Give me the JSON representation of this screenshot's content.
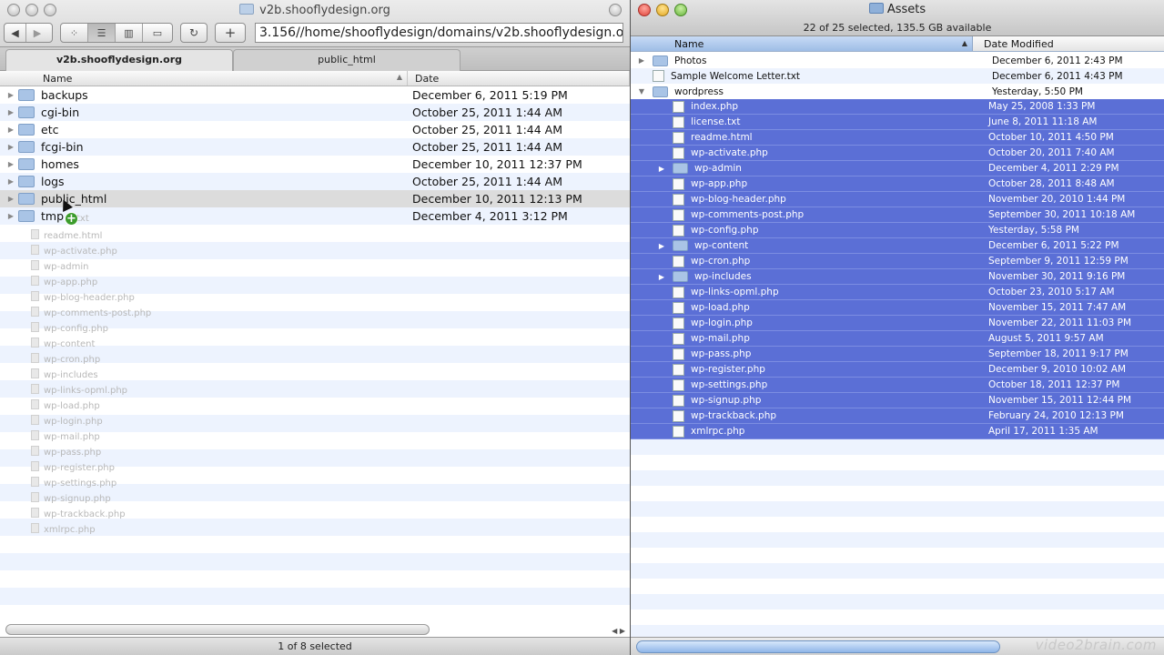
{
  "left_window": {
    "title": "v2b.shooflydesign.org",
    "path": "3.156//home/shooflydesign/domains/v2b.shooflydesign.org/",
    "add_label": "+",
    "tabs": [
      {
        "label": "v2b.shooflydesign.org"
      },
      {
        "label": "public_html"
      }
    ],
    "columns": {
      "name": "Name",
      "date": "Date"
    },
    "rows": [
      {
        "name": "backups",
        "date": "December 6, 2011 5:19 PM"
      },
      {
        "name": "cgi-bin",
        "date": "October 25, 2011 1:44 AM"
      },
      {
        "name": "etc",
        "date": "October 25, 2011 1:44 AM"
      },
      {
        "name": "fcgi-bin",
        "date": "October 25, 2011 1:44 AM"
      },
      {
        "name": "homes",
        "date": "December 10, 2011 12:37 PM"
      },
      {
        "name": "logs",
        "date": "October 25, 2011 1:44 AM"
      },
      {
        "name": "public_html",
        "date": "December 10, 2011 12:13 PM"
      },
      {
        "name": "tmp",
        "date": "December 4, 2011 3:12 PM"
      }
    ],
    "ghost_items": [
      "txt",
      "readme.html",
      "wp-activate.php",
      "wp-admin",
      "wp-app.php",
      "wp-blog-header.php",
      "wp-comments-post.php",
      "wp-config.php",
      "wp-content",
      "wp-cron.php",
      "wp-includes",
      "wp-links-opml.php",
      "wp-load.php",
      "wp-login.php",
      "wp-mail.php",
      "wp-pass.php",
      "wp-register.php",
      "wp-settings.php",
      "wp-signup.php",
      "wp-trackback.php",
      "xmlrpc.php"
    ],
    "status": "1 of 8 selected"
  },
  "right_window": {
    "title": "Assets",
    "info": "22 of 25 selected, 135.5 GB available",
    "columns": {
      "name": "Name",
      "date": "Date Modified"
    },
    "rows": [
      {
        "name": "Photos",
        "date": "December 6, 2011 2:43 PM"
      },
      {
        "name": "Sample Welcome Letter.txt",
        "date": "December 6, 2011 4:43 PM"
      },
      {
        "name": "wordpress",
        "date": "Yesterday, 5:50 PM"
      },
      {
        "name": "index.php",
        "date": "May 25, 2008 1:33 PM"
      },
      {
        "name": "license.txt",
        "date": "June 8, 2011 11:18 AM"
      },
      {
        "name": "readme.html",
        "date": "October 10, 2011 4:50 PM"
      },
      {
        "name": "wp-activate.php",
        "date": "October 20, 2011 7:40 AM"
      },
      {
        "name": "wp-admin",
        "date": "December 4, 2011 2:29 PM"
      },
      {
        "name": "wp-app.php",
        "date": "October 28, 2011 8:48 AM"
      },
      {
        "name": "wp-blog-header.php",
        "date": "November 20, 2010 1:44 PM"
      },
      {
        "name": "wp-comments-post.php",
        "date": "September 30, 2011 10:18 AM"
      },
      {
        "name": "wp-config.php",
        "date": "Yesterday, 5:58 PM"
      },
      {
        "name": "wp-content",
        "date": "December 6, 2011 5:22 PM"
      },
      {
        "name": "wp-cron.php",
        "date": "September 9, 2011 12:59 PM"
      },
      {
        "name": "wp-includes",
        "date": "November 30, 2011 9:16 PM"
      },
      {
        "name": "wp-links-opml.php",
        "date": "October 23, 2010 5:17 AM"
      },
      {
        "name": "wp-load.php",
        "date": "November 15, 2011 7:47 AM"
      },
      {
        "name": "wp-login.php",
        "date": "November 22, 2011 11:03 PM"
      },
      {
        "name": "wp-mail.php",
        "date": "August 5, 2011 9:57 AM"
      },
      {
        "name": "wp-pass.php",
        "date": "September 18, 2011 9:17 PM"
      },
      {
        "name": "wp-register.php",
        "date": "December 9, 2010 10:02 AM"
      },
      {
        "name": "wp-settings.php",
        "date": "October 18, 2011 12:37 PM"
      },
      {
        "name": "wp-signup.php",
        "date": "November 15, 2011 12:44 PM"
      },
      {
        "name": "wp-trackback.php",
        "date": "February 24, 2010 12:13 PM"
      },
      {
        "name": "xmlrpc.php",
        "date": "April 17, 2011 1:35 AM"
      }
    ]
  },
  "watermark": "video2brain.com",
  "colors": {
    "selection": "#5b6fd6",
    "stripe": "#edf3fe"
  }
}
